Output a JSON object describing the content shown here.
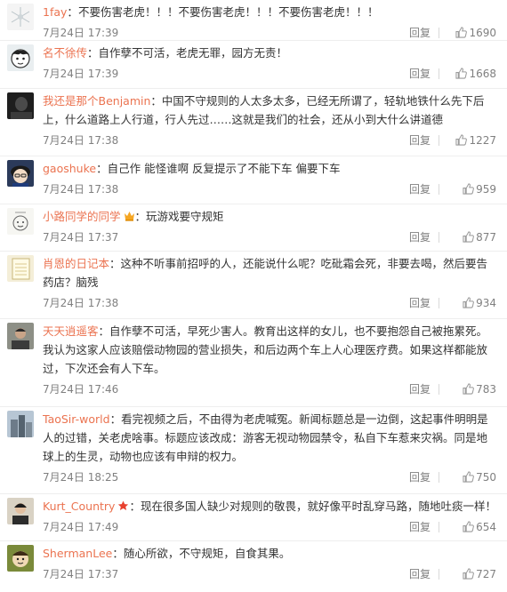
{
  "ui": {
    "reply_label": "回复",
    "colon": "："
  },
  "colors": {
    "username": "#eb7350",
    "meta": "#808080",
    "text": "#333333"
  },
  "comments": [
    {
      "user": "1fay",
      "text": "不要伤害老虎！！！不要伤害老虎！！！不要伤害老虎！！！",
      "time": "7月24日 17:39",
      "likes": "1690",
      "avatar": "avatar-dandelion"
    },
    {
      "user": "名不徐传",
      "text": "自作孽不可活，老虎无罪，园方无责！",
      "time": "7月24日 17:39",
      "likes": "1668",
      "avatar": "avatar-cartoon-boy"
    },
    {
      "user": "我还是那个Benjamin",
      "text": "中国不守规则的人太多太多，已经无所谓了，轻轨地铁什么先下后上，什么道路上人行道，行人先过……这就是我们的社会，还从小到大什么讲道德",
      "time": "7月24日 17:38",
      "likes": "1227",
      "avatar": "avatar-dark-photo"
    },
    {
      "user": "gaoshuke",
      "text": "自己作 能怪谁啊 反复提示了不能下车 偏要下车",
      "time": "7月24日 17:38",
      "likes": "959",
      "avatar": "avatar-anime-boy"
    },
    {
      "user": "小路同学的同学",
      "text": "玩游戏要守规矩",
      "time": "7月24日 17:37",
      "likes": "877",
      "avatar": "avatar-doodle",
      "badge": "vip-badge"
    },
    {
      "user": "肖恩的日记本",
      "text": "这种不听事前招呼的人，还能说什么呢？吃砒霜会死，非要去喝，然后要告药店？脑残",
      "time": "7月24日 17:38",
      "likes": "934",
      "avatar": "avatar-notebook"
    },
    {
      "user": "天天逍遥客",
      "text": "自作孽不可活，早死少害人。教育出这样的女儿，也不要抱怨自己被拖累死。我认为这家人应该赔偿动物园的营业损失，和后边两个车上人心理医疗费。如果这样都能放过，下次还会有人下车。",
      "time": "7月24日 17:46",
      "likes": "783",
      "avatar": "avatar-man-photo"
    },
    {
      "user": "TaoSir-world",
      "text": "看完视频之后，不由得为老虎喊冤。新闻标题总是一边倒，这起事件明明是人的过错，关老虎啥事。标题应该改成：游客无视动物园禁令，私自下车惹来灾祸。同是地球上的生灵，动物也应该有申辩的权力。",
      "time": "7月24日 18:25",
      "likes": "750",
      "avatar": "avatar-building-photo"
    },
    {
      "user": "Kurt_Country",
      "text": "现在很多国人缺少对规则的敬畏，就好像平时乱穿马路，随地吐痰一样！",
      "time": "7月24日 17:49",
      "likes": "654",
      "avatar": "avatar-person-photo",
      "badge": "star-badge"
    },
    {
      "user": "ShermanLee",
      "text": "随心所欲，不守规矩，自食其果。",
      "time": "7月24日 17:37",
      "likes": "727",
      "avatar": "avatar-cartoon-face"
    }
  ]
}
